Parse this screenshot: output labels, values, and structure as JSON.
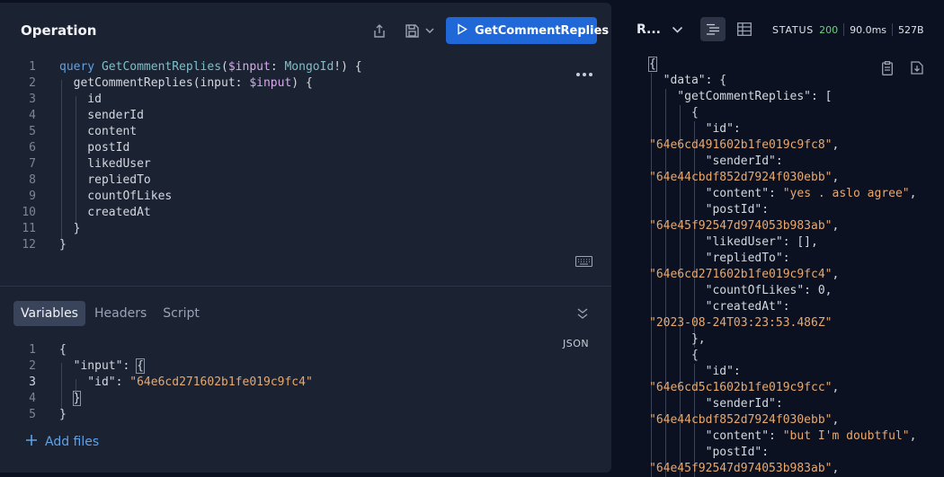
{
  "operation": {
    "title": "Operation",
    "run_label": "GetCommentReplies",
    "query_lines": [
      {
        "n": "1",
        "parts": [
          {
            "t": "query ",
            "c": "kw"
          },
          {
            "t": "GetCommentReplies",
            "c": "fn"
          },
          {
            "t": "(",
            "c": ""
          },
          {
            "t": "$input",
            "c": "var"
          },
          {
            "t": ": ",
            "c": ""
          },
          {
            "t": "MongoId",
            "c": "type"
          },
          {
            "t": "!) {",
            "c": ""
          }
        ]
      },
      {
        "n": "2",
        "parts": [
          {
            "t": "  getCommentReplies(input: ",
            "c": ""
          },
          {
            "t": "$input",
            "c": "var"
          },
          {
            "t": ") {",
            "c": ""
          }
        ]
      },
      {
        "n": "3",
        "parts": [
          {
            "t": "    id",
            "c": ""
          }
        ]
      },
      {
        "n": "4",
        "parts": [
          {
            "t": "    senderId",
            "c": ""
          }
        ]
      },
      {
        "n": "5",
        "parts": [
          {
            "t": "    content",
            "c": ""
          }
        ]
      },
      {
        "n": "6",
        "parts": [
          {
            "t": "    postId",
            "c": ""
          }
        ]
      },
      {
        "n": "7",
        "parts": [
          {
            "t": "    likedUser",
            "c": ""
          }
        ]
      },
      {
        "n": "8",
        "parts": [
          {
            "t": "    repliedTo",
            "c": ""
          }
        ]
      },
      {
        "n": "9",
        "parts": [
          {
            "t": "    countOfLikes",
            "c": ""
          }
        ]
      },
      {
        "n": "10",
        "parts": [
          {
            "t": "    createdAt",
            "c": ""
          }
        ]
      },
      {
        "n": "11",
        "parts": [
          {
            "t": "  }",
            "c": ""
          }
        ]
      },
      {
        "n": "12",
        "parts": [
          {
            "t": "}",
            "c": ""
          }
        ]
      }
    ]
  },
  "bottom_tabs": [
    {
      "label": "Variables",
      "active": true
    },
    {
      "label": "Headers",
      "active": false
    },
    {
      "label": "Script",
      "active": false
    }
  ],
  "json_label": "JSON",
  "variables_lines": [
    {
      "n": "1",
      "parts": [
        {
          "t": "{",
          "c": ""
        }
      ]
    },
    {
      "n": "2",
      "parts": [
        {
          "t": "  \"input\": ",
          "c": ""
        },
        {
          "t": "{",
          "c": "caret"
        }
      ]
    },
    {
      "n": "3",
      "parts": [
        {
          "t": "    \"id\": ",
          "c": ""
        },
        {
          "t": "\"64e6cd271602b1fe019c9fc4\"",
          "c": "str"
        }
      ],
      "current": true
    },
    {
      "n": "4",
      "parts": [
        {
          "t": "  ",
          "c": ""
        },
        {
          "t": "}",
          "c": "caret"
        }
      ]
    },
    {
      "n": "5",
      "parts": [
        {
          "t": "}",
          "c": ""
        }
      ]
    }
  ],
  "add_files_label": "Add files",
  "response": {
    "title": "R...",
    "status_label": "STATUS",
    "status_code": "200",
    "time": "90.0ms",
    "size": "527B",
    "lines": [
      [
        {
          "t": "{",
          "c": "caret"
        }
      ],
      [
        {
          "t": "  \"data\": {",
          "c": ""
        }
      ],
      [
        {
          "t": "    \"getCommentReplies\": [",
          "c": ""
        }
      ],
      [
        {
          "t": "      {",
          "c": ""
        }
      ],
      [
        {
          "t": "        \"id\":",
          "c": ""
        }
      ],
      [
        {
          "t": "\"64e6cd491602b1fe019c9fc8\"",
          "c": "str"
        },
        {
          "t": ",",
          "c": ""
        }
      ],
      [
        {
          "t": "        \"senderId\":",
          "c": ""
        }
      ],
      [
        {
          "t": "\"64e44cbdf852d7924f030ebb\"",
          "c": "str"
        },
        {
          "t": ",",
          "c": ""
        }
      ],
      [
        {
          "t": "        \"content\": ",
          "c": ""
        },
        {
          "t": "\"yes . aslo agree\"",
          "c": "str"
        },
        {
          "t": ",",
          "c": ""
        }
      ],
      [
        {
          "t": "        \"postId\":",
          "c": ""
        }
      ],
      [
        {
          "t": "\"64e45f92547d974053b983ab\"",
          "c": "str"
        },
        {
          "t": ",",
          "c": ""
        }
      ],
      [
        {
          "t": "        \"likedUser\": [],",
          "c": ""
        }
      ],
      [
        {
          "t": "        \"repliedTo\":",
          "c": ""
        }
      ],
      [
        {
          "t": "\"64e6cd271602b1fe019c9fc4\"",
          "c": "str"
        },
        {
          "t": ",",
          "c": ""
        }
      ],
      [
        {
          "t": "        \"countOfLikes\": 0,",
          "c": ""
        }
      ],
      [
        {
          "t": "        \"createdAt\":",
          "c": ""
        }
      ],
      [
        {
          "t": "\"2023-08-24T03:23:53.486Z\"",
          "c": "str"
        }
      ],
      [
        {
          "t": "      },",
          "c": ""
        }
      ],
      [
        {
          "t": "      {",
          "c": ""
        }
      ],
      [
        {
          "t": "        \"id\":",
          "c": ""
        }
      ],
      [
        {
          "t": "\"64e6cd5c1602b1fe019c9fcc\"",
          "c": "str"
        },
        {
          "t": ",",
          "c": ""
        }
      ],
      [
        {
          "t": "        \"senderId\":",
          "c": ""
        }
      ],
      [
        {
          "t": "\"64e44cbdf852d7924f030ebb\"",
          "c": "str"
        },
        {
          "t": ",",
          "c": ""
        }
      ],
      [
        {
          "t": "        \"content\": ",
          "c": ""
        },
        {
          "t": "\"but I'm doubtful\"",
          "c": "str"
        },
        {
          "t": ",",
          "c": ""
        }
      ],
      [
        {
          "t": "        \"postId\":",
          "c": ""
        }
      ],
      [
        {
          "t": "\"64e45f92547d974053b983ab\"",
          "c": "str"
        },
        {
          "t": ",",
          "c": ""
        }
      ]
    ]
  },
  "colors": {
    "accent": "#2068d8",
    "status_ok": "#6fcf83",
    "string": "#e8a970",
    "keyword": "#5ea2e8"
  },
  "icons": [
    "share-icon",
    "save-icon",
    "chevron-down-icon",
    "play-icon",
    "more-icon",
    "keyboard-icon",
    "collapse-icon",
    "plus-icon",
    "list-view-icon",
    "table-view-icon",
    "copy-icon",
    "download-icon"
  ]
}
